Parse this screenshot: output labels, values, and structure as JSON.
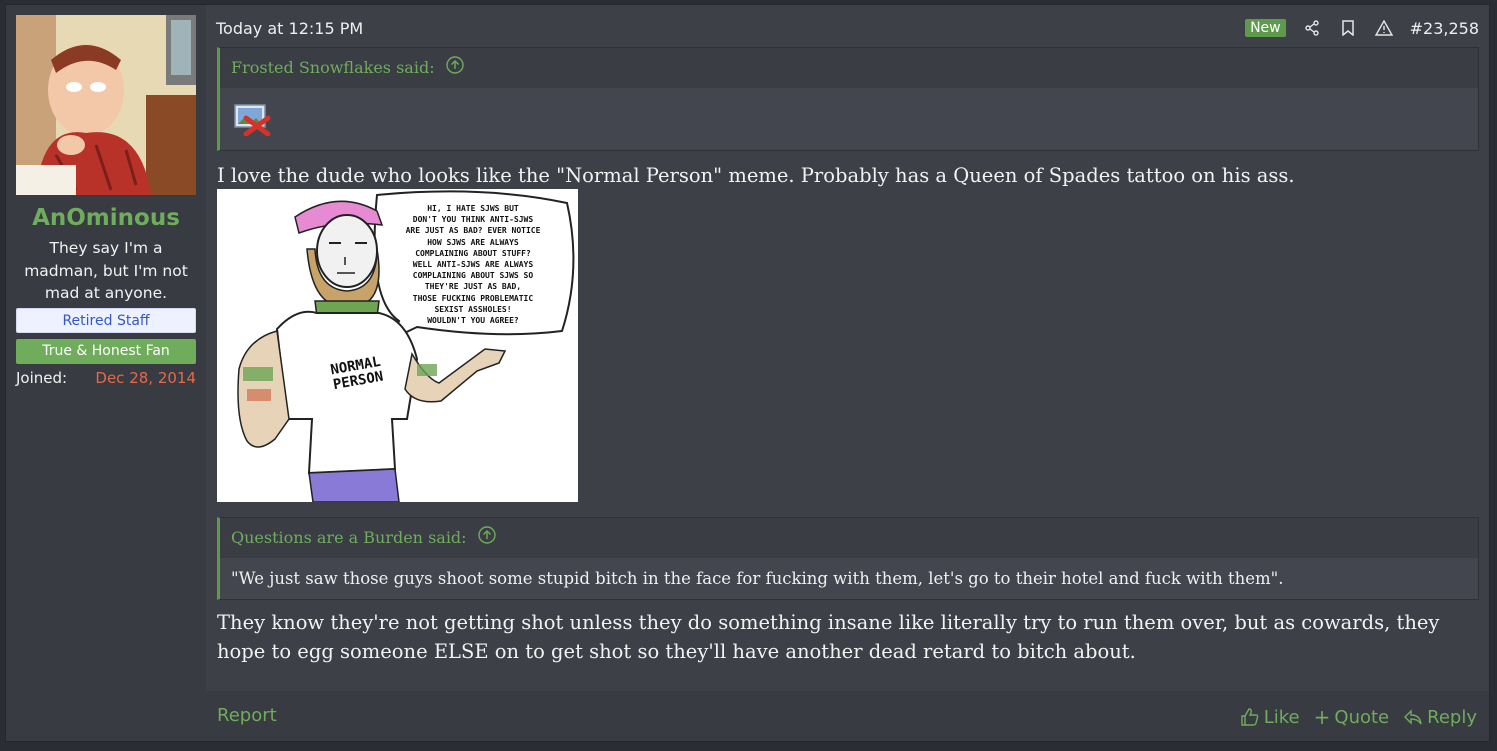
{
  "user": {
    "name": "AnOminous",
    "title": "They say I'm a madman, but I'm not mad at anyone.",
    "banners": [
      "Retired Staff",
      "True & Honest Fan"
    ],
    "joined_label": "Joined:",
    "joined_value": "Dec 28, 2014"
  },
  "post": {
    "date": "Today at 12:15 PM",
    "new_badge": "New",
    "number": "#23,258",
    "quote1": {
      "author": "Frosted Snowflakes said:"
    },
    "message1": "I love the dude who looks like the \"Normal Person\" meme. Probably has a Queen of Spades tattoo on his ass.",
    "meme": {
      "speech": [
        "HI, I HATE SJWS BUT",
        "DON'T YOU THINK ANTI-SJWS",
        "ARE JUST AS BAD? EVER NOTICE",
        "HOW SJWS ARE ALWAYS",
        "COMPLAINING ABOUT STUFF?",
        "WELL ANTI-SJWS ARE ALWAYS",
        "COMPLAINING ABOUT SJWS SO",
        "THEY'RE JUST AS BAD,",
        "THOSE FUCKING PROBLEMATIC",
        "SEXIST ASSHOLES!",
        "WOULDN'T YOU AGREE?"
      ],
      "shirt_line1": "NORMAL",
      "shirt_line2": "PERSON"
    },
    "quote2": {
      "author": "Questions are a Burden said:",
      "text": "\"We just saw those guys shoot some stupid bitch in the face for fucking with them, let's go to their hotel and fuck with them\"."
    },
    "message2": "They know they're not getting shot unless they do something insane like literally try to run them over, but as cowards, they hope to egg someone ELSE on to get shot so they'll have another dead retard to bitch about."
  },
  "footer": {
    "report": "Report",
    "like": "Like",
    "quote": "Quote",
    "reply": "Reply"
  },
  "colors": {
    "accent_green": "#6fac5b",
    "joined_date": "#e5694a",
    "staff_banner_text": "#3358c6"
  }
}
